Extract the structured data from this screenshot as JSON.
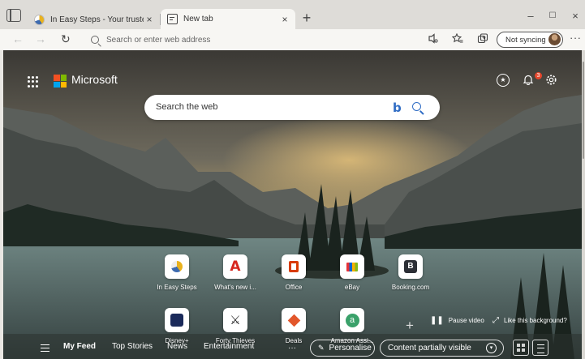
{
  "tabs": [
    {
      "title": "In Easy Steps - Your trusted sour",
      "close": "×"
    },
    {
      "title": "New tab",
      "close": "×"
    }
  ],
  "new_tab": "+",
  "window": {
    "minimize": "–",
    "maximize": "☐",
    "close": "×"
  },
  "toolbar": {
    "back": "←",
    "forward": "→",
    "reload": "↻",
    "address_placeholder": "Search or enter web address",
    "sync_label": "Not syncing",
    "more": "···"
  },
  "ntp": {
    "brand": "Microsoft",
    "notification_count": "3",
    "search_placeholder": "Search the web",
    "bing": "b",
    "quick_links_row1": [
      {
        "label": "In Easy Steps",
        "icon": "in-easy-steps-icon"
      },
      {
        "label": "What's new i...",
        "icon": "adobe-icon"
      },
      {
        "label": "Office",
        "icon": "office-icon"
      },
      {
        "label": "eBay",
        "icon": "ebay-icon"
      },
      {
        "label": "Booking.com",
        "icon": "booking-icon"
      }
    ],
    "quick_links_row2": [
      {
        "label": "Disney+",
        "icon": "disney-plus-icon"
      },
      {
        "label": "Forty Thieves",
        "icon": "forty-thieves-icon"
      },
      {
        "label": "Deals",
        "icon": "deals-icon"
      },
      {
        "label": "Amazon Assi...",
        "icon": "amazon-icon"
      }
    ],
    "add_tile": "+",
    "pause_video": "Pause video",
    "like_background": "Like this background?",
    "feed_tabs": [
      "My Feed",
      "Top Stories",
      "News",
      "Entertainment"
    ],
    "more_dots": "···",
    "personalise": "Personalise",
    "content_visibility": "Content partially visible"
  },
  "colors": {
    "ms_red": "#f25022",
    "ms_green": "#7fba00",
    "ms_blue": "#00a4ef",
    "ms_yellow": "#ffb900",
    "bing_blue": "#2f6cc4",
    "badge_red": "#e5472d"
  }
}
